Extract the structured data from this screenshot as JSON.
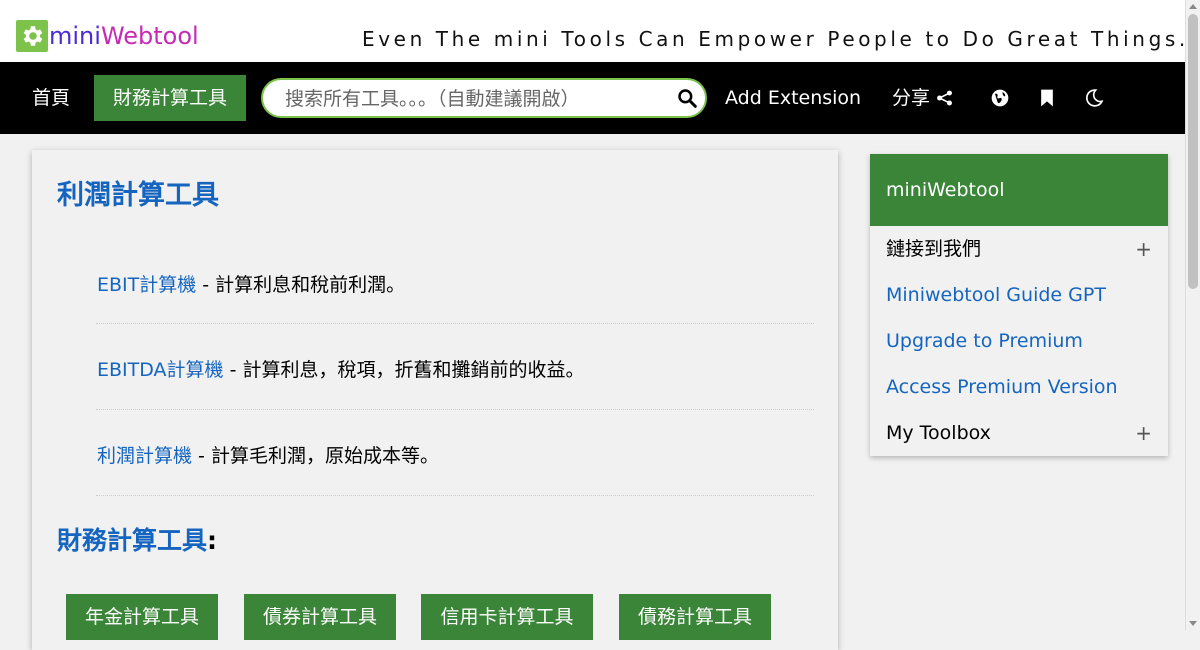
{
  "header": {
    "logo_mini": "mini",
    "logo_webtool": "Webtool",
    "tagline": "Even The mini Tools Can Empower People to Do Great Things."
  },
  "nav": {
    "home": "首頁",
    "active": "財務計算工具",
    "search_placeholder": "搜索所有工具。。。（自動建議開啟）",
    "add_extension": "Add Extension",
    "share": "分享",
    "icons": [
      "search-icon",
      "share-icon",
      "globe-icon",
      "bookmark-icon",
      "moon-icon"
    ]
  },
  "main": {
    "title": "利潤計算工具",
    "tools": [
      {
        "name": "EBIT計算機",
        "desc": " - 計算利息和稅前利潤。"
      },
      {
        "name": "EBITDA計算機",
        "desc": " - 計算利息，稅項，折舊和攤銷前的收益。"
      },
      {
        "name": "利潤計算機",
        "desc": " - 計算毛利潤，原始成本等。"
      }
    ],
    "subtitle": "財務計算工具",
    "subtitle_colon": ":",
    "categories": [
      "年金計算工具",
      "債券計算工具",
      "信用卡計算工具",
      "債務計算工具"
    ]
  },
  "sidebar": {
    "title": "miniWebtool",
    "items": [
      {
        "label": "鏈接到我們",
        "expand": "+"
      },
      {
        "label": "Miniwebtool Guide GPT"
      },
      {
        "label": "Upgrade to Premium"
      },
      {
        "label": "Access Premium Version"
      },
      {
        "label": "My Toolbox",
        "expand": "+"
      }
    ]
  },
  "colors": {
    "brand_green": "#3b8539",
    "logo_green": "#7cc24b",
    "link_blue": "#1565c0",
    "logo_purple": "#4a2cd3",
    "logo_magenta": "#c52bb5"
  }
}
